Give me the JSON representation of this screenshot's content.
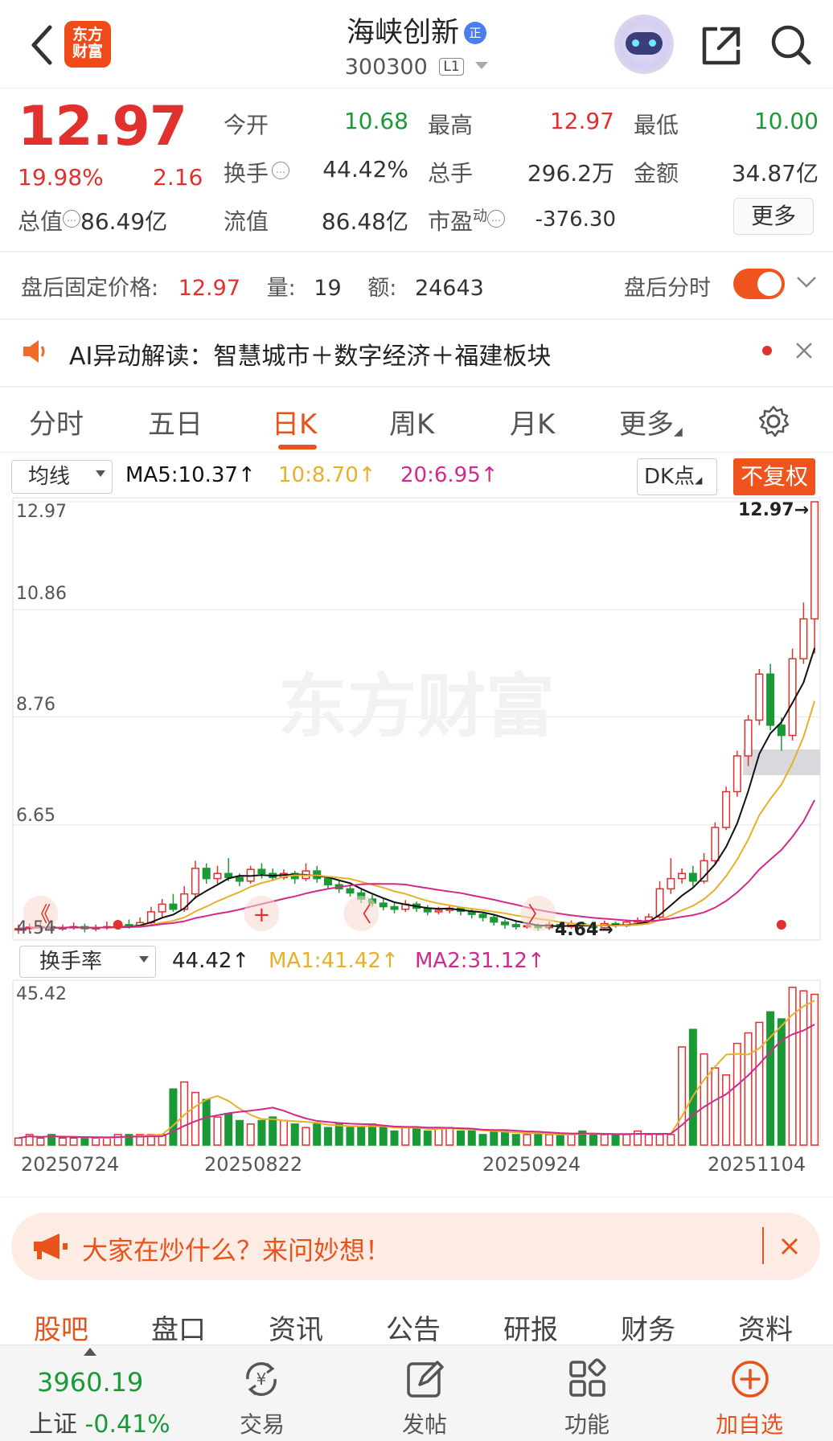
{
  "header": {
    "logo_text": "东方财富",
    "stock_name": "海峡创新",
    "badge": "正",
    "code": "300300",
    "level": "L1"
  },
  "quote": {
    "price": "12.97",
    "change_pct": "19.98%",
    "change_amt": "2.16",
    "open_label": "今开",
    "open": "10.68",
    "high_label": "最高",
    "high": "12.97",
    "low_label": "最低",
    "low": "10.00",
    "turnover_label": "换手",
    "turnover": "44.42%",
    "volume_label": "总手",
    "volume": "296.2万",
    "amount_label": "金额",
    "amount": "34.87亿",
    "total_mv_label": "总值",
    "total_mv": "86.49亿",
    "float_mv_label": "流值",
    "float_mv": "86.48亿",
    "pe_label": "市盈",
    "pe_sup": "动",
    "pe": "-376.30",
    "more_label": "更多"
  },
  "after_hours": {
    "price_label": "盘后固定价格:",
    "price": "12.97",
    "vol_label": "量:",
    "vol": "19",
    "amt_label": "额:",
    "amt": "24643",
    "timeshare_label": "盘后分时"
  },
  "ai_notice": {
    "text": "AI异动解读：智慧城市＋数字经济＋福建板块"
  },
  "tabs": [
    {
      "label": "分时"
    },
    {
      "label": "五日"
    },
    {
      "label": "日K"
    },
    {
      "label": "周K"
    },
    {
      "label": "月K"
    },
    {
      "label": "更多"
    }
  ],
  "chart_controls": {
    "ma_select": "均线",
    "ma5": "MA5:10.37↑",
    "ma10": "10:8.70↑",
    "ma20": "20:6.95↑",
    "dk_label": "DK点",
    "fq_label": "不复权",
    "watermark": "东方财富",
    "y_labels": [
      "12.97",
      "10.86",
      "8.76",
      "6.65",
      "4.54"
    ],
    "last_price_tag": "12.97→",
    "low_price_tag": "4.64→",
    "turnover_select": "换手率",
    "turnover_val": "44.42↑",
    "tma1": "MA1:41.42↑",
    "tma2": "MA2:31.12↑",
    "turnover_max": "45.42",
    "dates": [
      "20250724",
      "20250822",
      "20250924",
      "20251104"
    ]
  },
  "chart_data": {
    "type": "candlestick",
    "ylim": [
      4.54,
      12.97
    ],
    "candles": [
      [
        4.6,
        4.62,
        4.7,
        4.52
      ],
      [
        4.62,
        4.65,
        4.72,
        4.56
      ],
      [
        4.64,
        4.66,
        4.75,
        4.58
      ],
      [
        4.66,
        4.63,
        4.72,
        4.55
      ],
      [
        4.63,
        4.64,
        4.7,
        4.58
      ],
      [
        4.64,
        4.66,
        4.74,
        4.6
      ],
      [
        4.66,
        4.62,
        4.72,
        4.55
      ],
      [
        4.62,
        4.64,
        4.7,
        4.57
      ],
      [
        4.64,
        4.66,
        4.76,
        4.6
      ],
      [
        4.66,
        4.7,
        4.78,
        4.62
      ],
      [
        4.7,
        4.68,
        4.8,
        4.62
      ],
      [
        4.68,
        4.74,
        4.84,
        4.64
      ],
      [
        4.74,
        4.95,
        5.05,
        4.7
      ],
      [
        4.95,
        5.1,
        5.2,
        4.85
      ],
      [
        5.1,
        5.0,
        5.3,
        4.95
      ],
      [
        5.0,
        5.3,
        5.45,
        4.95
      ],
      [
        5.3,
        5.8,
        5.95,
        5.2
      ],
      [
        5.8,
        5.6,
        5.9,
        5.5
      ],
      [
        5.6,
        5.7,
        5.85,
        5.5
      ],
      [
        5.7,
        5.62,
        6.0,
        5.55
      ],
      [
        5.62,
        5.55,
        5.7,
        5.45
      ],
      [
        5.55,
        5.78,
        5.85,
        5.5
      ],
      [
        5.78,
        5.7,
        5.9,
        5.6
      ],
      [
        5.7,
        5.62,
        5.8,
        5.55
      ],
      [
        5.62,
        5.7,
        5.78,
        5.58
      ],
      [
        5.7,
        5.6,
        5.75,
        5.5
      ],
      [
        5.6,
        5.75,
        5.9,
        5.55
      ],
      [
        5.75,
        5.6,
        5.85,
        5.52
      ],
      [
        5.6,
        5.48,
        5.65,
        5.4
      ],
      [
        5.48,
        5.4,
        5.55,
        5.32
      ],
      [
        5.4,
        5.32,
        5.48,
        5.25
      ],
      [
        5.32,
        5.2,
        5.38,
        5.12
      ],
      [
        5.2,
        5.12,
        5.28,
        5.05
      ],
      [
        5.12,
        5.05,
        5.2,
        4.98
      ],
      [
        5.05,
        5.0,
        5.12,
        4.92
      ],
      [
        5.0,
        5.1,
        5.18,
        4.95
      ],
      [
        5.1,
        5.02,
        5.15,
        4.95
      ],
      [
        5.02,
        4.95,
        5.08,
        4.88
      ],
      [
        4.95,
        4.98,
        5.05,
        4.9
      ],
      [
        4.98,
        5.02,
        5.08,
        4.92
      ],
      [
        5.02,
        4.96,
        5.05,
        4.88
      ],
      [
        4.96,
        4.9,
        5.0,
        4.82
      ],
      [
        4.9,
        4.84,
        4.95,
        4.76
      ],
      [
        4.84,
        4.75,
        4.88,
        4.68
      ],
      [
        4.75,
        4.7,
        4.8,
        4.62
      ],
      [
        4.7,
        4.66,
        4.76,
        4.6
      ],
      [
        4.66,
        4.68,
        4.74,
        4.62
      ],
      [
        4.68,
        4.64,
        4.72,
        4.58
      ],
      [
        4.64,
        4.7,
        4.76,
        4.6
      ],
      [
        4.7,
        4.66,
        4.74,
        4.62
      ],
      [
        4.66,
        4.72,
        4.78,
        4.62
      ],
      [
        4.72,
        4.68,
        4.76,
        4.64
      ],
      [
        4.68,
        4.64,
        4.72,
        4.56
      ],
      [
        4.64,
        4.72,
        4.78,
        4.6
      ],
      [
        4.72,
        4.68,
        4.76,
        4.64
      ],
      [
        4.68,
        4.75,
        4.8,
        4.65
      ],
      [
        4.75,
        4.78,
        4.84,
        4.72
      ],
      [
        4.78,
        4.85,
        4.92,
        4.76
      ],
      [
        4.85,
        5.4,
        5.55,
        4.8
      ],
      [
        5.4,
        5.6,
        6.0,
        5.3
      ],
      [
        5.6,
        5.7,
        5.8,
        5.5
      ],
      [
        5.7,
        5.55,
        5.85,
        5.45
      ],
      [
        5.55,
        5.95,
        6.1,
        5.5
      ],
      [
        5.95,
        6.6,
        6.7,
        5.9
      ],
      [
        6.6,
        7.3,
        7.4,
        6.55
      ],
      [
        7.3,
        8.0,
        8.1,
        7.2
      ],
      [
        8.0,
        8.7,
        8.8,
        7.8
      ],
      [
        8.7,
        9.6,
        9.7,
        8.6
      ],
      [
        9.6,
        8.6,
        9.8,
        8.5
      ],
      [
        8.6,
        8.4,
        8.75,
        8.1
      ],
      [
        8.4,
        9.9,
        10.1,
        8.3
      ],
      [
        9.9,
        10.68,
        11.0,
        9.8
      ],
      [
        10.68,
        12.97,
        12.97,
        10.0
      ]
    ],
    "turnover": [
      2,
      3,
      2,
      3,
      2,
      2,
      2,
      2,
      2,
      3,
      3,
      3,
      3,
      3,
      16,
      18,
      15,
      13,
      8,
      9,
      7,
      6,
      7,
      8,
      7,
      6,
      5,
      6,
      5,
      6,
      5,
      5,
      6,
      5,
      4,
      5,
      5,
      4,
      5,
      5,
      4,
      4,
      3,
      4,
      4,
      3,
      3,
      3,
      3,
      3,
      3,
      4,
      3,
      3,
      3,
      3,
      4,
      3,
      3,
      3,
      28,
      33,
      26,
      22,
      20,
      29,
      32,
      35,
      38,
      36,
      45,
      44,
      43
    ]
  },
  "promo_banner": {
    "text": "大家在炒什么？来问妙想！"
  },
  "bottom_tabs": [
    {
      "label": "股吧"
    },
    {
      "label": "盘口"
    },
    {
      "label": "资讯"
    },
    {
      "label": "公告"
    },
    {
      "label": "研报"
    },
    {
      "label": "财务"
    },
    {
      "label": "资料"
    }
  ],
  "bottom_nav": {
    "index_value": "3960.19",
    "index_name": "上证",
    "index_change": "-0.41%",
    "items": [
      {
        "label": "交易"
      },
      {
        "label": "发帖"
      },
      {
        "label": "功能"
      },
      {
        "label": "加自选"
      }
    ]
  },
  "colors": {
    "up": "#e0312f",
    "down": "#1a9a36",
    "accent": "#e8531c",
    "ma5": "#111111",
    "ma10": "#e8b02a",
    "ma20": "#d12a8c"
  }
}
